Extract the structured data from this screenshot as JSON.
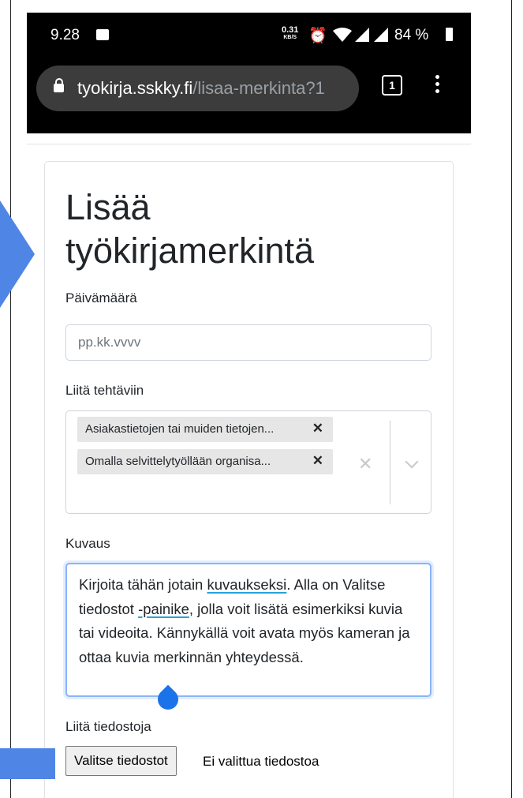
{
  "status_bar": {
    "time": "9.28",
    "net_speed": "0.31",
    "net_unit": "KB/S",
    "battery": "84 %"
  },
  "browser": {
    "url_host": "tyokirja.sskky.fi",
    "url_path": "/lisaa-merkinta?1",
    "tab_count": "1"
  },
  "form": {
    "title_line1": "Lisää",
    "title_line2": "työkirjamerkintä",
    "date": {
      "label": "Päivämäärä",
      "placeholder": "pp.kk.vvvv",
      "value": ""
    },
    "tasks": {
      "label": "Liitä tehtäviin",
      "selected": [
        {
          "label": "Asiakastietojen tai muiden tietojen..."
        },
        {
          "label": "Omalla selvittelytyöllään organisa..."
        }
      ]
    },
    "description": {
      "label": "Kuvaus",
      "text_parts": [
        "Kirjoita tähän jotain ",
        "kuvaukseksi",
        ". Alla on Valitse tiedostot ",
        "-painike",
        ", jolla voit lisätä esimerkiksi kuvia tai videoita. Kännykällä voit avata myös kameran ja ottaa kuvia merkinnän yhteydessä."
      ]
    },
    "files": {
      "label": "Liitä tiedostoja",
      "button_label": "Valitse tiedostot",
      "status": "Ei valittua tiedostoa"
    }
  },
  "colors": {
    "annotation_arrow": "#4f86e6",
    "focus_border": "#8ab4f8",
    "spell_underline": "#26a3d9"
  }
}
